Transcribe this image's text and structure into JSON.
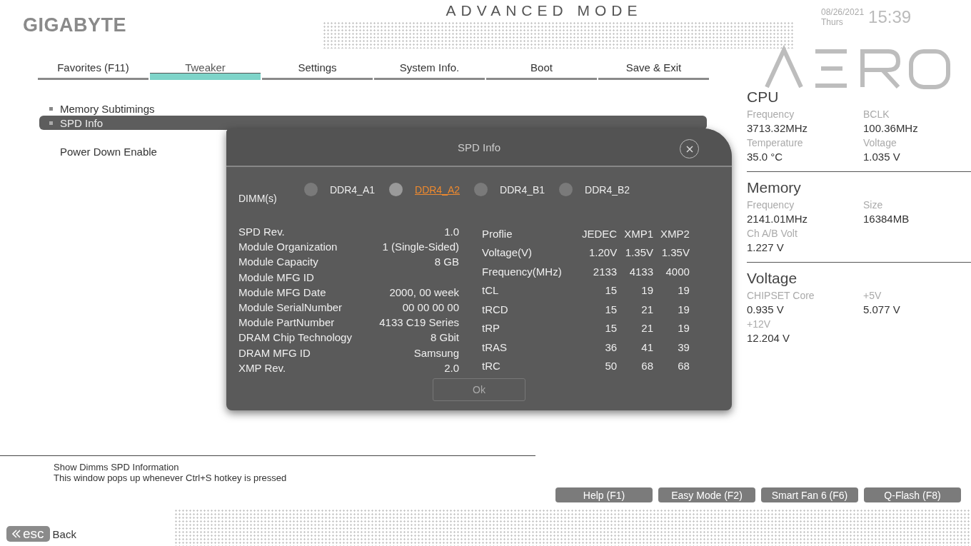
{
  "header": {
    "brand": "GIGABYTE",
    "mode_title": "ADVANCED MODE",
    "date": "08/26/2021",
    "day": "Thurs",
    "time": "15:39"
  },
  "tabs": [
    {
      "label": "Favorites (F11)",
      "selected": false
    },
    {
      "label": "Tweaker",
      "selected": true
    },
    {
      "label": "Settings",
      "selected": false
    },
    {
      "label": "System Info.",
      "selected": false
    },
    {
      "label": "Boot",
      "selected": false
    },
    {
      "label": "Save & Exit",
      "selected": false
    }
  ],
  "menu_items": [
    {
      "label": "Memory Subtimings",
      "kind": "submenu",
      "selected": false
    },
    {
      "label": "SPD Info",
      "kind": "submenu",
      "selected": true
    },
    {
      "label": "Power Down Enable",
      "kind": "setting",
      "selected": false
    }
  ],
  "dialog": {
    "title": "SPD Info",
    "dimm_label": "DIMM(s)",
    "dimms": [
      {
        "label": "DDR4_A1",
        "selected": false
      },
      {
        "label": "DDR4_A2",
        "selected": true
      },
      {
        "label": "DDR4_B1",
        "selected": false
      },
      {
        "label": "DDR4_B2",
        "selected": false
      }
    ],
    "spd_fields": [
      {
        "label": "SPD Rev.",
        "value": "1.0"
      },
      {
        "label": "Module Organization",
        "value": "1 (Single-Sided)"
      },
      {
        "label": "Module Capacity",
        "value": "8 GB"
      },
      {
        "label": "Module MFG ID"
      },
      {
        "label": "Module MFG Date",
        "value": "2000, 00 week"
      },
      {
        "label": "Module SerialNumber",
        "value": "00 00 00 00"
      },
      {
        "label": "Module PartNumber",
        "value": "4133 C19 Series"
      },
      {
        "label": "DRAM Chip Technology",
        "value": "8 Gbit"
      },
      {
        "label": "DRAM MFG ID",
        "value": "Samsung"
      },
      {
        "label": "XMP Rev.",
        "value": "2.0"
      }
    ],
    "profile_table": {
      "columns": [
        "Proflie",
        "JEDEC",
        "XMP1",
        "XMP2"
      ],
      "rows": [
        [
          "Voltage(V)",
          "1.20V",
          "1.35V",
          "1.35V"
        ],
        [
          "Frequency(MHz)",
          "2133",
          "4133",
          "4000"
        ],
        [
          "tCL",
          "15",
          "19",
          "19"
        ],
        [
          "tRCD",
          "15",
          "21",
          "19"
        ],
        [
          "tRP",
          "15",
          "21",
          "19"
        ],
        [
          "tRAS",
          "36",
          "41",
          "39"
        ],
        [
          "tRC",
          "50",
          "68",
          "68"
        ]
      ]
    },
    "ok_button": "Ok"
  },
  "side_panel": [
    {
      "title": "CPU",
      "items": [
        {
          "label": "Frequency",
          "value": "3713.32MHz"
        },
        {
          "label": "BCLK",
          "value": "100.36MHz"
        },
        {
          "label": "Temperature",
          "value": "35.0 °C"
        },
        {
          "label": "Voltage",
          "value": "1.035 V"
        }
      ]
    },
    {
      "title": "Memory",
      "items": [
        {
          "label": "Frequency",
          "value": "2141.01MHz"
        },
        {
          "label": "Size",
          "value": "16384MB"
        },
        {
          "label": "Ch A/B Volt",
          "value": "1.227 V"
        }
      ]
    },
    {
      "title": "Voltage",
      "items": [
        {
          "label": "CHIPSET Core",
          "value": "0.935 V"
        },
        {
          "label": "+5V",
          "value": "5.077 V"
        },
        {
          "label": "+12V",
          "value": "12.204 V"
        }
      ]
    }
  ],
  "help_text": [
    "Show Dimms SPD Information",
    "This window pops up whenever Ctrl+S hotkey is pressed"
  ],
  "function_buttons": [
    "Help (F1)",
    "Easy Mode (F2)",
    "Smart Fan 6 (F6)",
    "Q-Flash (F8)"
  ],
  "back": {
    "key": "esc",
    "label": "Back"
  }
}
